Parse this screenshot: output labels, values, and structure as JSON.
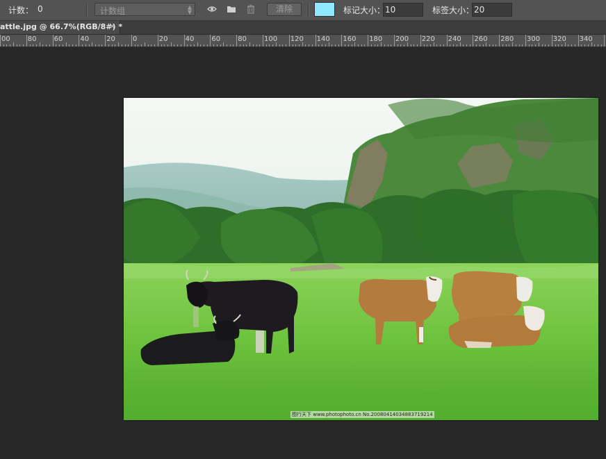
{
  "options_bar": {
    "count_label": "计数：",
    "count_value": "0",
    "group_select": "计数组",
    "clear_label": "清除",
    "swatch_color": "#8fe9ff",
    "marker_size_label": "标记大小：",
    "marker_size_value": "10",
    "label_size_label": "标签大小：",
    "label_size_value": "20"
  },
  "tab": {
    "title": "attle.jpg @ 66.7%(RGB/8#) *",
    "close": "×"
  },
  "ruler": {
    "labels": [
      "00",
      "80",
      "60",
      "40",
      "20",
      "0",
      "20",
      "40",
      "60",
      "80",
      "100",
      "120",
      "140",
      "160",
      "180",
      "200",
      "220",
      "240",
      "260",
      "280",
      "300",
      "320",
      "340",
      "36"
    ]
  },
  "image": {
    "watermark": "图行天下 www.photophoto.cn  No.20080414034883719214"
  }
}
